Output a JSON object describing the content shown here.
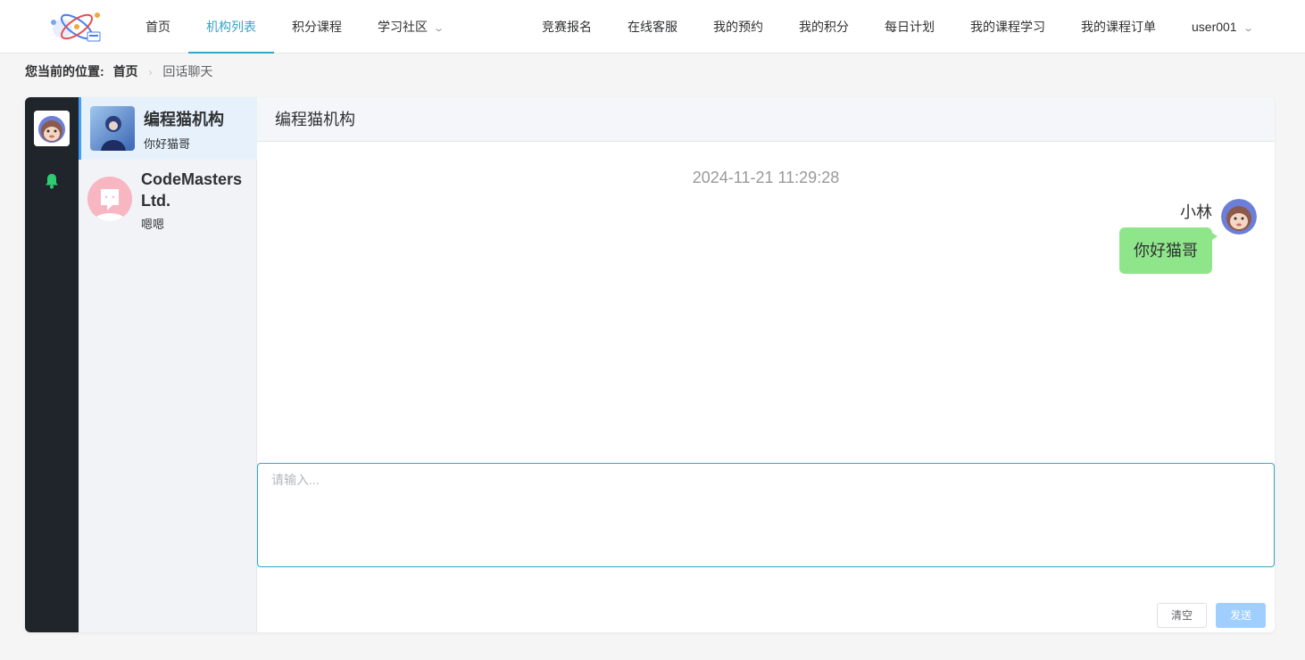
{
  "nav": {
    "left_items": [
      "首页",
      "机构列表",
      "积分课程",
      "学习社区"
    ],
    "right_items": [
      "竞赛报名",
      "在线客服",
      "我的预约",
      "我的积分",
      "每日计划",
      "我的课程学习",
      "我的课程订单"
    ],
    "user": "user001",
    "active": "机构列表",
    "accent": "#36a3c9"
  },
  "breadcrumb": {
    "lead": "您当前的位置:",
    "home": "首页",
    "current": "回话聊天"
  },
  "conversations": [
    {
      "name": "编程猫机构",
      "last_message": "你好猫哥",
      "active": true
    },
    {
      "name": "CodeMasters Ltd.",
      "last_message": "嗯嗯",
      "active": false
    }
  ],
  "chat": {
    "title": "编程猫机构",
    "timestamp": "2024-11-21 11:29:28",
    "messages": [
      {
        "sender": "小林",
        "text": "你好猫哥",
        "bubble_color": "#8fe68a"
      }
    ],
    "input_placeholder": "请输入...",
    "clear_label": "清空",
    "send_label": "发送"
  },
  "icons": {
    "logo": "atom-logo-icon",
    "bell": "bell-icon",
    "chevron": "chevron-down-icon"
  }
}
